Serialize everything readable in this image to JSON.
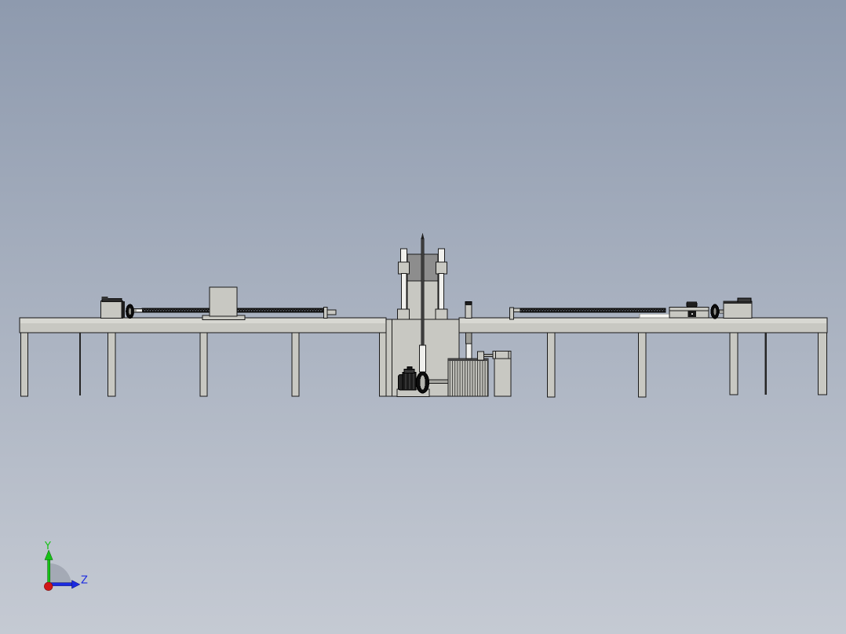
{
  "canvas": {
    "background_top": "#8e9aae",
    "background_bottom": "#c5cad3"
  },
  "colors": {
    "part_fill": "#c8c8c2",
    "part_fill_light": "#d8d8d2",
    "part_dark_panel": "#8d8d8d",
    "outline": "#1a1a1a",
    "metal_white": "#f0f0ed",
    "shaft_gray": "#a8a8a2"
  },
  "triad": {
    "y_label": "Y",
    "z_label": "Z",
    "y_color": "#16c216",
    "z_color": "#1b2ae0",
    "x_color": "#d11717"
  }
}
